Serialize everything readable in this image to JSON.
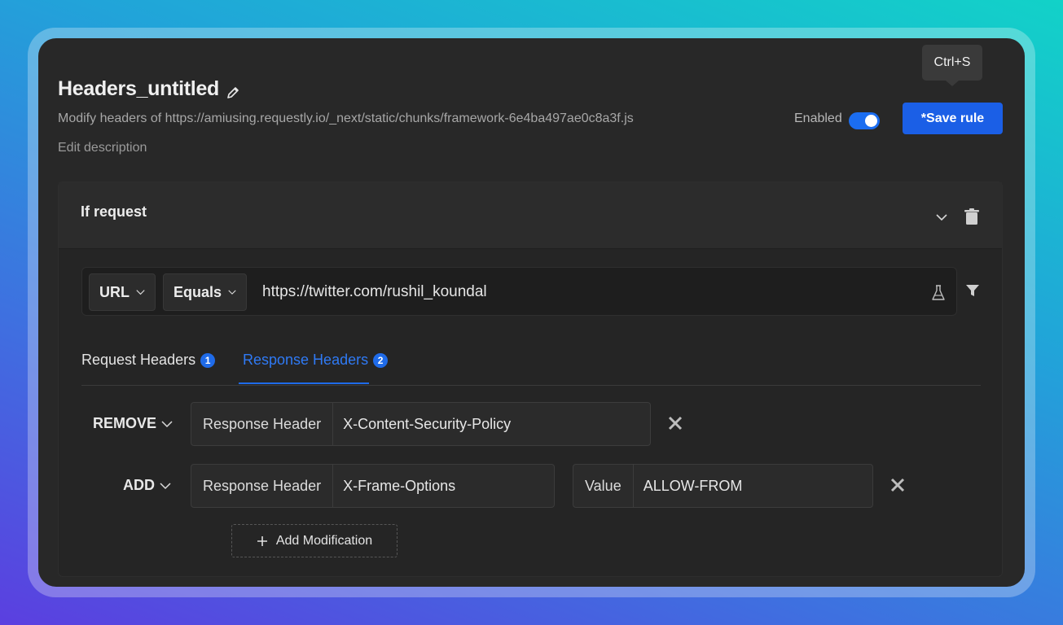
{
  "rule": {
    "title": "Headers_untitled",
    "description": "Modify headers of https://amiusing.requestly.io/_next/static/chunks/framework-6e4ba497ae0c8a3f.js",
    "edit_description": "Edit description",
    "enabled_label": "Enabled",
    "save_label": "*Save rule",
    "tooltip": "Ctrl+S"
  },
  "condition": {
    "header": "If request",
    "source_type": "URL",
    "operator": "Equals",
    "value": "https://twitter.com/rushil_koundal"
  },
  "tabs": [
    {
      "label": "Request Headers",
      "count": "1",
      "active": false
    },
    {
      "label": "Response Headers",
      "count": "2",
      "active": true
    }
  ],
  "modifications": [
    {
      "type": "REMOVE",
      "header_label": "Response Header",
      "header_value": "X-Content-Security-Policy"
    },
    {
      "type": "ADD",
      "header_label": "Response Header",
      "header_value": "X-Frame-Options",
      "value_label": "Value",
      "value": "ALLOW-FROM"
    }
  ],
  "add_modification_label": "Add Modification",
  "colors": {
    "accent": "#1b5fe6",
    "active_tab": "#2f7af5",
    "background": "#282828"
  },
  "icons": [
    "pencil-icon",
    "chevron-down-icon",
    "trash-icon",
    "flask-icon",
    "filter-icon",
    "close-icon",
    "plus-icon"
  ]
}
